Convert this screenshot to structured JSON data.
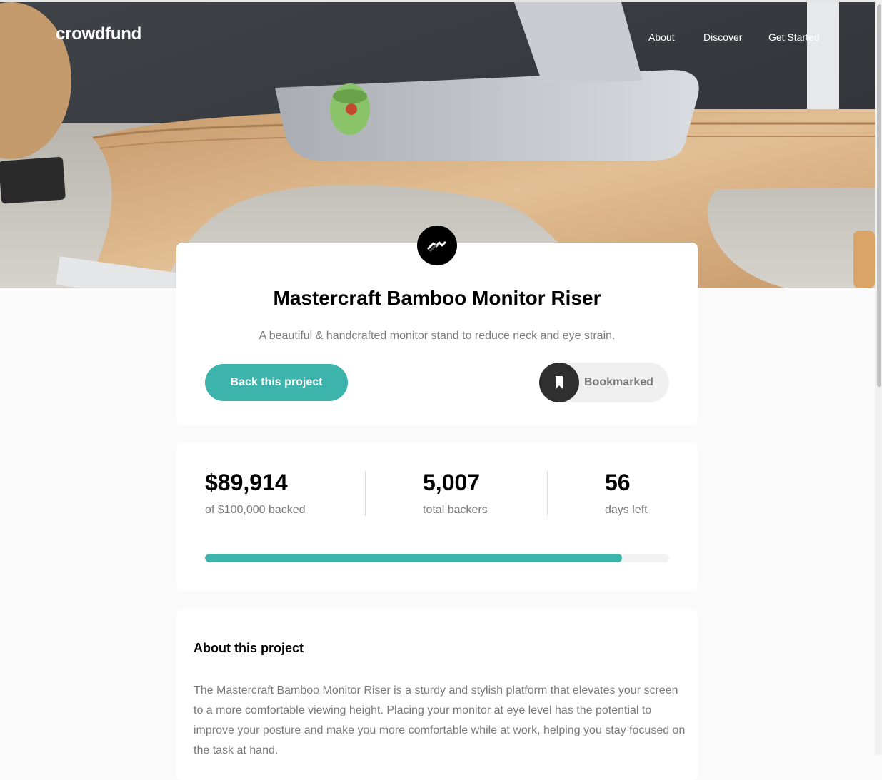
{
  "header": {
    "logo": "crowdfund",
    "nav": [
      "About",
      "Discover",
      "Get Started"
    ]
  },
  "project": {
    "title": "Mastercraft Bamboo Monitor Riser",
    "subtitle": "A beautiful & handcrafted monitor stand to reduce neck and eye strain.",
    "back_button": "Back this project",
    "bookmark_label": "Bookmarked",
    "bookmark_icon": "bookmark-icon",
    "brand_icon": "mastercraft-logo-icon"
  },
  "stats": {
    "backed_amount": "$89,914",
    "backed_label": "of $100,000 backed",
    "backers": "5,007",
    "backers_label": "total backers",
    "days": "56",
    "days_label": "days left",
    "progress_fraction": 0.89914
  },
  "about": {
    "title": "About this project",
    "paragraph": "The Mastercraft Bamboo Monitor Riser is a sturdy and stylish platform that elevates your screen to a more comfortable viewing height. Placing your monitor at eye level has the potential to improve your posture and make you more comfortable while at work, helping you stay focused on the task at hand."
  },
  "colors": {
    "accent": "#3cb3ab",
    "dark": "#2f2f2f",
    "muted_text": "#7a7a7a",
    "background": "#fafafa"
  }
}
